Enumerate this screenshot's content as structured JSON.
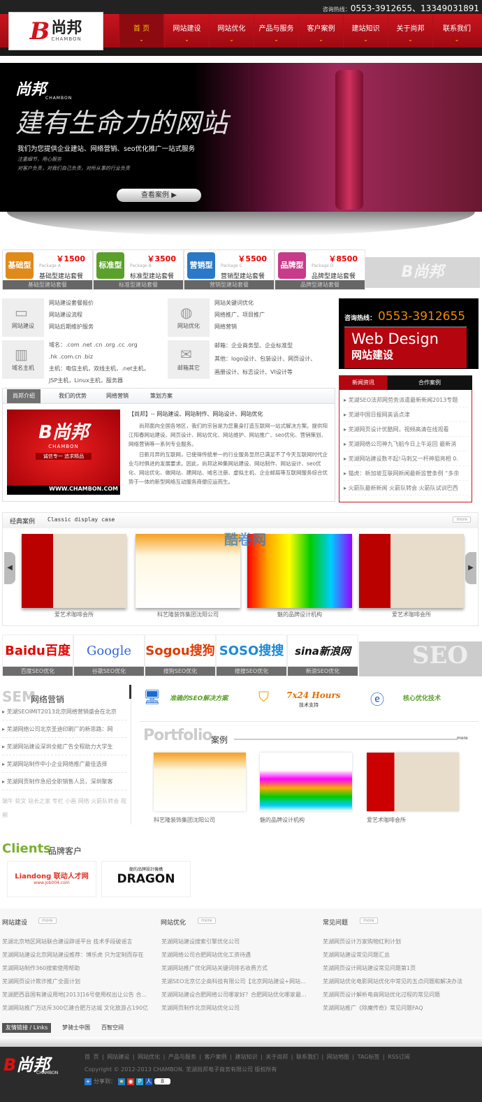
{
  "header": {
    "hotline_label": "咨询热线：",
    "hotline": "0553-3912655、13349031891",
    "logo_text": "尚邦",
    "logo_en": "CHAMBON",
    "nav": [
      "首 页",
      "网站建设",
      "网站优化",
      "产品与服务",
      "客户案例",
      "建站知识",
      "关于尚邦",
      "联系我们"
    ]
  },
  "banner": {
    "logo": "尚邦",
    "logo_en": "CHAMBON",
    "slogan": "建有生命力的网站",
    "subtitle": "我们为您提供企业建站、网络营销、seo优化推广一站式服务",
    "line1": "注重细节，用心服务",
    "line2": "对客户负责，对我们自己负责，对所从事的行业负责",
    "button": "查看案例"
  },
  "packages": [
    {
      "icon": "基础型",
      "price": "￥1500",
      "en": "Package A",
      "name": "基础型建站套餐",
      "bar": "基础型建站套餐",
      "color": "#e08a1a"
    },
    {
      "icon": "标准型",
      "price": "￥3500",
      "en": "Package B",
      "name": "标准型建站套餐",
      "bar": "标准型建站套餐",
      "color": "#5aa02a"
    },
    {
      "icon": "营销型",
      "price": "￥5500",
      "en": "Package C",
      "name": "营销型建站套餐",
      "bar": "营销型建站套餐",
      "color": "#2a78c8"
    },
    {
      "icon": "品牌型",
      "price": "￥8500",
      "en": "Package D",
      "name": "品牌型建站套餐",
      "bar": "品牌型建站套餐",
      "color": "#c83a8a"
    }
  ],
  "services": [
    {
      "label": "网站建设",
      "lines": [
        "网站建设套餐报价",
        "网站建设流程",
        "网站后期维护服务"
      ]
    },
    {
      "label": "网站优化",
      "lines": [
        "网站关键词优化",
        "网络推广、项目推广",
        "网络营销"
      ]
    },
    {
      "label": "域名主机",
      "lines": [
        "域名：.com .net .cn .org .cc .org",
        ".hk .com.cn .biz",
        "主机：电信主机，双线主机，.net主机，",
        "JSP主机，Linux主机，服务器"
      ]
    },
    {
      "label": "邮箱其它",
      "lines": [
        "邮箱：企业商务型、企业标准型",
        "其他：logo设计、包装设计、网页设计、",
        "画册设计、标志设计、VI设计等"
      ]
    }
  ],
  "hot": {
    "label": "咨询热线：",
    "phone": "0553-3912655",
    "en": "Web Design",
    "cn": "网站建设"
  },
  "news": {
    "tabs": [
      "新闻资讯",
      "合作案例"
    ],
    "items": [
      "芜湖SEO法邦网劳务派遣最新新闻2013专题",
      "芜湖中国日报网英语点津",
      "芜湖网页设计优酷网，视频高清在线观看",
      "芜湖网络公司神九飞船今日上午返回 最新消",
      "芜湖网站建设数不起!马刺又一杆神狙亮相 0.",
      "猫虎：新加坡互联网新闻最新监管条例 “多余",
      "火箭队最新新闻 火箭队转会 火箭队试训巴西"
    ]
  },
  "intro": {
    "tabs": [
      "尚邦介绍",
      "我们的优势",
      "网络营销",
      "策划方案"
    ],
    "img_slogan": "诚信专一 追求精品",
    "img_url": "WWW.CHAMBON.COM",
    "title": "【尚邦】-- 网站建设、网站制作、网站设计、网站优化",
    "p1": "尚邦面向全国各地区，我们的宗旨是为您量身打造互联网一站式解决方案。提供阳江阳春网站建设、网页设计、网站优化、网站维护、网站推广、seo优化、营销策划、网络营销等一系列专业服务。",
    "p2": "日新月异的互联网，已使得传统单一的行业服务显然已满足不了今天互联网时代企业与时俱进的发展要求。因此，尚邦这种集网站建设、网站制作、网站设计、seo优化、网站优化、做网站、建网站、域名注册、虚拟主机、企业邮局等互联网服务综合优势于一体的新型网络互动服务商便应运而生。"
  },
  "cases": {
    "title": "经典案例",
    "en": "Classic display case",
    "more": "more",
    "items": [
      "爱艺术咖啡会所",
      "科艺隆装饰集团沈阳公司",
      "魅的品牌设计机构",
      "爱艺术咖啡会所"
    ]
  },
  "engines": [
    {
      "logo": "Baidu百度",
      "cap": "百度SEO优化"
    },
    {
      "logo": "Google",
      "cap": "谷歌SEO优化"
    },
    {
      "logo": "Sogou搜狗",
      "cap": "搜狗SEO优化"
    },
    {
      "logo": "SOSO搜搜",
      "cap": "搜搜SEO优化"
    },
    {
      "logo": "sina新浪网",
      "cap": "新浪SEO优化"
    }
  ],
  "seo_badge": "SEO",
  "sem": {
    "title_en": "SEM",
    "title": "网络营销",
    "items": [
      "芜湖SEOIMIT2013北京网络营销盛会在北京",
      "芜湖网络公司北京圣迪印刷厂的新思路：网",
      "芜湖网站建设深圳全能广告全程助力大学生",
      "芜湖网站制作中小企业网络推广最佳选择",
      "芜湖网页制作急招全职销售人员，深圳聚客"
    ],
    "tags": "端午 软文 站长之家 专栏 小画 网络 火箭队转会 视频"
  },
  "features": [
    {
      "text": "准确的SEO解决方案"
    },
    {
      "text": "7x24 Hours",
      "sub": "技术支持"
    },
    {
      "text": "核心优化技术"
    }
  ],
  "portfolio": {
    "title_en": "Portfolio",
    "title": "案例",
    "more": "more",
    "items": [
      "科艺隆装饰集团沈阳公司",
      "魅的品牌设计机构",
      "爱艺术咖啡会所"
    ]
  },
  "clients": {
    "title_en": "Clients",
    "title": "品牌客户",
    "items": [
      {
        "name": "Liandong 联动人才网",
        "sub": "www.job004.com"
      },
      {
        "name": "DRAGON",
        "sub": "龍的品牌設計機構"
      }
    ]
  },
  "footer_cols": [
    {
      "title": "网站建设",
      "more": "more",
      "items": [
        "芜湖北京地区网站联合建设辟谣平台 技术手段破谣言",
        "芜湖网站建设北京网站建设推荐：博乐虎 只为定制而存在",
        "芜湖网站制作360搜索使用帮助",
        "芜湖网页设计欺诈推广全面计划",
        "芜湖肥西县国有建设用地[2013]16号使用权出让公告 合...",
        "芜湖网站推广万达斥300亿建合肥万达城 文化旅游占190亿"
      ]
    },
    {
      "title": "网站优化",
      "more": "more",
      "items": [
        "芜湖网站建设搜索引擎优化公司",
        "芜湖网络公司合肥网站优化工资待遇",
        "芜湖网站推广优化网站关键词排名收费方式",
        "芜湖SEO北京亿企商科技有限公司【北京网站建设+网站...",
        "芜湖网站建设合肥网络公司哪家好？合肥网站优化哪家最...",
        "芜湖网页制作北京网站优化公司"
      ]
    },
    {
      "title": "常见问题",
      "more": "more",
      "items": [
        "芜湖网页设计万家购物红利计划",
        "芜湖网站建设常见问题汇总",
        "芜湖网页设计网站建设常见问题第1页",
        "芜湖网站优化电影网站优化中常见的五点问题和解决办法",
        "芜湖网页设计解析电商网站优化过程的常见问题",
        "芜湖网站推广《除魔传奇》常见问题FAQ"
      ]
    }
  ],
  "links": {
    "label": "友情链接 / Links",
    "items": [
      "梦骑士中国",
      "百智空间"
    ]
  },
  "footer": {
    "nav": [
      "首 页",
      "网站建设",
      "网站优化",
      "产品与服务",
      "客户案例",
      "建站知识",
      "关于尚邦",
      "联系我们",
      "网站地图",
      "TAG标签",
      "RSS订阅"
    ],
    "copyright": "Copyright © 2012-2013 CHAMBON. 芜湖尚邦电子商务有限公司 版权所有",
    "share": "分享到：",
    "share_count": "8"
  },
  "watermark": "酷卷网"
}
